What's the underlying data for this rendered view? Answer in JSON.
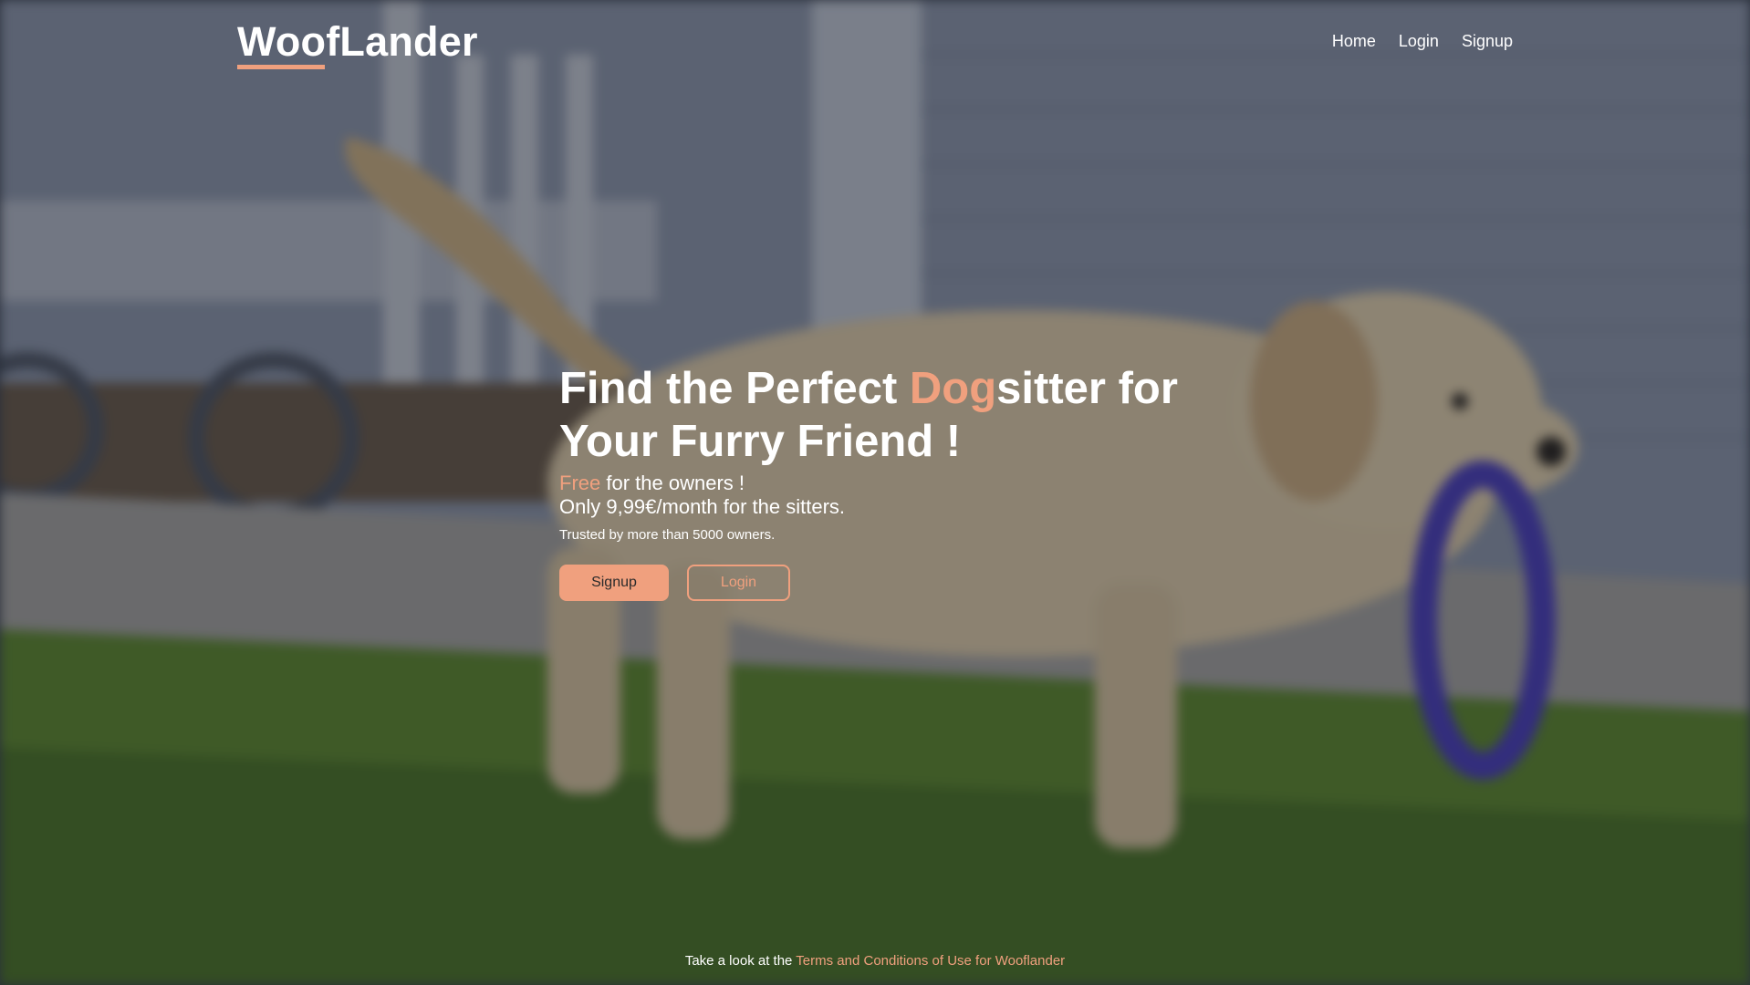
{
  "brand": {
    "name": "WoofLander",
    "accent_color": "#f0a07e"
  },
  "nav": {
    "items": [
      {
        "label": "Home"
      },
      {
        "label": "Login"
      },
      {
        "label": "Signup"
      }
    ]
  },
  "hero": {
    "headline_part1": "Find the Perfect ",
    "headline_accent": "Dog",
    "headline_part2": "sitter for Your Furry Friend !",
    "free_word": "Free",
    "free_rest": " for the owners !",
    "sitter_price": "Only 9,99€/month for the sitters.",
    "trusted": "Trusted by more than 5000 owners.",
    "signup_label": "Signup",
    "login_label": "Login"
  },
  "footer": {
    "prefix": "Take a look at the ",
    "link_text": "Terms and Conditions of Use for Wooflander"
  },
  "background": {
    "subject": "golden retriever puppy carrying a purple ring toy on a lawn"
  }
}
